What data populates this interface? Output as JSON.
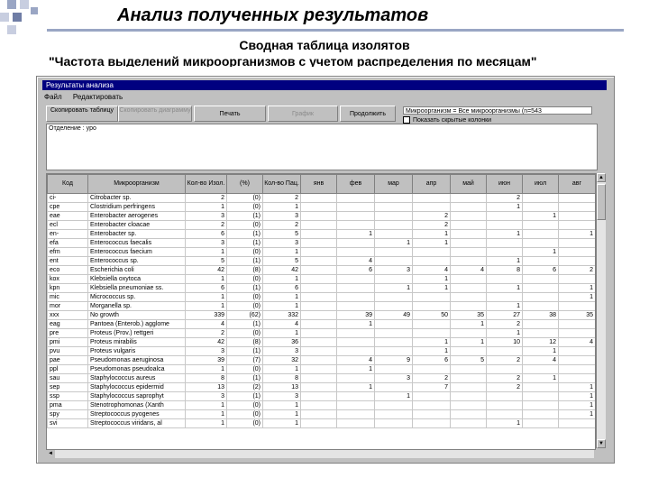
{
  "slide": {
    "title": "Анализ полученных результатов",
    "subtitle1": "Сводная таблица изолятов",
    "subtitle2": "\"Частота выделений микроорганизмов с учетом распределения по месяцам\"",
    "accent_color": "#9aa6c4"
  },
  "window": {
    "title": "Результаты анализа",
    "menu": [
      "Файл",
      "Редактировать"
    ],
    "toolbar": {
      "copy_table": "Скопировать таблицу",
      "copy_chart": "Скопировать диаграмму",
      "print": "Печать",
      "chart": "График",
      "continue": "Продолжить"
    },
    "filter_info": "Микроорганизм = Все микроорганизмы  (n=543",
    "show_hidden_label": "Показать скрытые колонки",
    "department": "Отделение : уро"
  },
  "table": {
    "headers": [
      "Код",
      "Микроорганизм",
      "Кол-во Изол.",
      "(%)",
      "Кол-во Пац.",
      "янв",
      "фев",
      "мар",
      "апр",
      "май",
      "июн",
      "июл",
      "авг"
    ],
    "rows": [
      [
        "ci-",
        "Citrobacter sp.",
        "2",
        "(0)",
        "2",
        "",
        "",
        "",
        "",
        "",
        "2",
        "",
        ""
      ],
      [
        "cpe",
        "Clostridium perfringens",
        "1",
        "(0)",
        "1",
        "",
        "",
        "",
        "",
        "",
        "1",
        "",
        ""
      ],
      [
        "eae",
        "Enterobacter aerogenes",
        "3",
        "(1)",
        "3",
        "",
        "",
        "",
        "2",
        "",
        "",
        "1",
        ""
      ],
      [
        "ecl",
        "Enterobacter cloacae",
        "2",
        "(0)",
        "2",
        "",
        "",
        "",
        "2",
        "",
        "",
        "",
        ""
      ],
      [
        "en-",
        "Enterobacter sp.",
        "6",
        "(1)",
        "5",
        "",
        "1",
        "",
        "1",
        "",
        "1",
        "",
        "1"
      ],
      [
        "efa",
        "Enterococcus faecalis",
        "3",
        "(1)",
        "3",
        "",
        "",
        "1",
        "1",
        "",
        "",
        "",
        ""
      ],
      [
        "efm",
        "Enterococcus faecium",
        "1",
        "(0)",
        "1",
        "",
        "",
        "",
        "",
        "",
        "",
        "1",
        ""
      ],
      [
        "ent",
        "Enterococcus sp.",
        "5",
        "(1)",
        "5",
        "",
        "4",
        "",
        "",
        "",
        "1",
        "",
        ""
      ],
      [
        "eco",
        "Escherichia coli",
        "42",
        "(8)",
        "42",
        "",
        "6",
        "3",
        "4",
        "4",
        "8",
        "6",
        "2"
      ],
      [
        "kox",
        "Klebsiella oxytoca",
        "1",
        "(0)",
        "1",
        "",
        "",
        "",
        "1",
        "",
        "",
        "",
        ""
      ],
      [
        "kpn",
        "Klebsiella pneumoniae ss.",
        "6",
        "(1)",
        "6",
        "",
        "",
        "1",
        "1",
        "",
        "1",
        "",
        "1"
      ],
      [
        "mic",
        "Micrococcus sp.",
        "1",
        "(0)",
        "1",
        "",
        "",
        "",
        "",
        "",
        "",
        "",
        "1"
      ],
      [
        "mor",
        "Morganella sp.",
        "1",
        "(0)",
        "1",
        "",
        "",
        "",
        "",
        "",
        "1",
        "",
        ""
      ],
      [
        "xxx",
        "No growth",
        "339",
        "(62)",
        "332",
        "",
        "39",
        "49",
        "50",
        "35",
        "27",
        "38",
        "35"
      ],
      [
        "eag",
        "Pantoea (Enterob.) agglome",
        "4",
        "(1)",
        "4",
        "",
        "1",
        "",
        "",
        "1",
        "2",
        "",
        ""
      ],
      [
        "pre",
        "Proteus (Prov.) rettgeri",
        "2",
        "(0)",
        "1",
        "",
        "",
        "",
        "",
        "",
        "1",
        "",
        ""
      ],
      [
        "pmi",
        "Proteus mirabilis",
        "42",
        "(8)",
        "36",
        "",
        "",
        "",
        "1",
        "1",
        "10",
        "12",
        "4"
      ],
      [
        "pvu",
        "Proteus vulgaris",
        "3",
        "(1)",
        "3",
        "",
        "",
        "",
        "1",
        "",
        "",
        "1",
        ""
      ],
      [
        "pae",
        "Pseudomonas aeruginosa",
        "39",
        "(7)",
        "32",
        "",
        "4",
        "9",
        "6",
        "5",
        "2",
        "4",
        ""
      ],
      [
        "ppl",
        "Pseudomonas pseudoalca",
        "1",
        "(0)",
        "1",
        "",
        "1",
        "",
        "",
        "",
        "",
        "",
        ""
      ],
      [
        "sau",
        "Staphylococcus aureus",
        "8",
        "(1)",
        "8",
        "",
        "",
        "3",
        "2",
        "",
        "2",
        "1",
        ""
      ],
      [
        "sep",
        "Staphylococcus epidermid",
        "13",
        "(2)",
        "13",
        "",
        "1",
        "",
        "7",
        "",
        "2",
        "",
        "1"
      ],
      [
        "ssp",
        "Staphylococcus saprophyt",
        "3",
        "(1)",
        "3",
        "",
        "",
        "1",
        "",
        "",
        "",
        "",
        "1"
      ],
      [
        "pma",
        "Stenotrophomonas (Xanth",
        "1",
        "(0)",
        "1",
        "",
        "",
        "",
        "",
        "",
        "",
        "",
        "1"
      ],
      [
        "spy",
        "Streptococcus pyogenes",
        "1",
        "(0)",
        "1",
        "",
        "",
        "",
        "",
        "",
        "",
        "",
        "1"
      ],
      [
        "svi",
        "Streptococcus viridans, al",
        "1",
        "(0)",
        "1",
        "",
        "",
        "",
        "",
        "",
        "1",
        "",
        ""
      ]
    ]
  }
}
